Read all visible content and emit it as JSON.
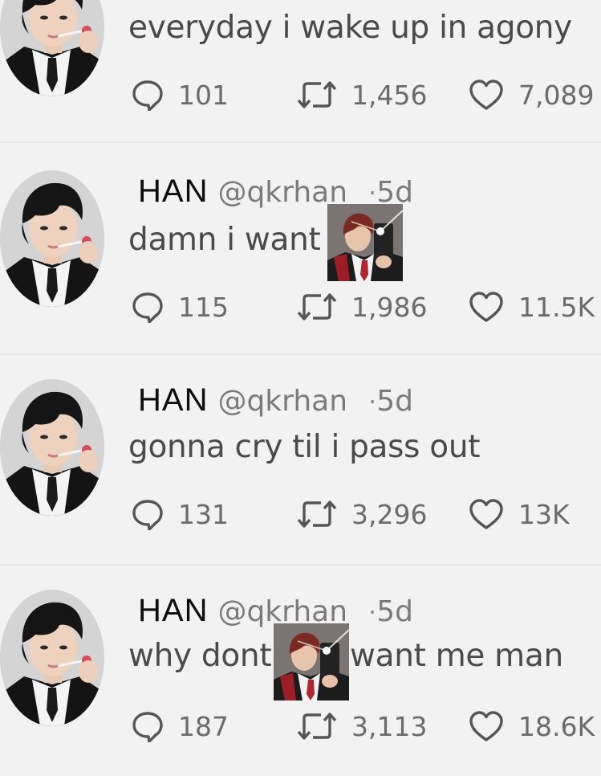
{
  "colors": {
    "background": "#f2f2f2",
    "text": "#4a4a4a",
    "muted": "#7b7b7b",
    "name": "#0d0d0d"
  },
  "icons": {
    "reply": "speech-bubble-icon",
    "retweet": "retweet-arrows-icon",
    "like": "heart-icon"
  },
  "tweets": [
    {
      "name": "",
      "handle": "",
      "time": "",
      "text": "everyday i wake up in agony",
      "replies": "101",
      "retweets": "1,456",
      "likes": "7,089"
    },
    {
      "name": "HAN",
      "handle": "@qkrhan",
      "time": "5d",
      "text_before": "damn i want",
      "text_after": "",
      "replies": "115",
      "retweets": "1,986",
      "likes": "11.5K"
    },
    {
      "name": "HAN",
      "handle": "@qkrhan",
      "time": "5d",
      "text": "gonna cry til i pass out",
      "replies": "131",
      "retweets": "3,296",
      "likes": "13K"
    },
    {
      "name": "HAN",
      "handle": "@qkrhan",
      "time": "5d",
      "text_before": "why dont",
      "text_after": "want me man",
      "replies": "187",
      "retweets": "3,113",
      "likes": "18.6K"
    }
  ]
}
